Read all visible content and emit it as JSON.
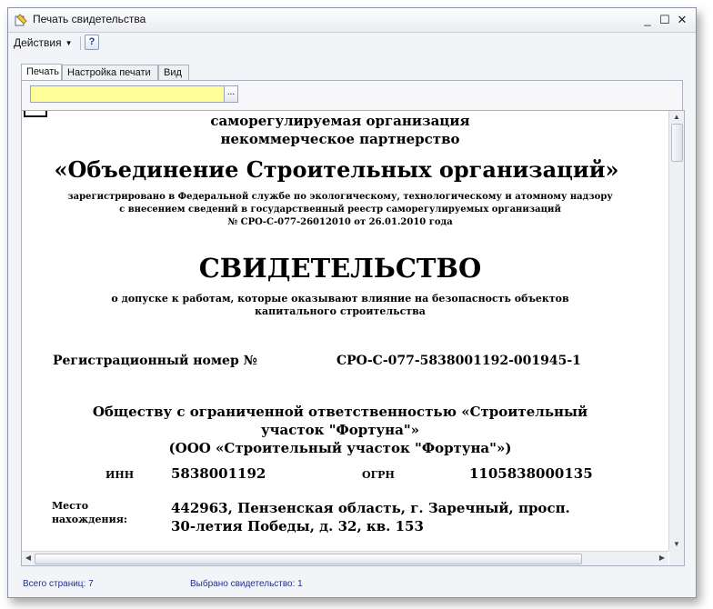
{
  "window": {
    "title": "Печать свидетельства",
    "controls": {
      "minimize": "_",
      "maximize": "☐",
      "close": "✕"
    }
  },
  "toolbar": {
    "actions_label": "Действия",
    "help_label": "?"
  },
  "tabs": [
    {
      "label": "Печать"
    },
    {
      "label": "Настройка печати"
    },
    {
      "label": "Вид"
    }
  ],
  "field": {
    "value": "",
    "button_label": "..."
  },
  "document": {
    "line1": "саморегулируемая организация",
    "line2": "некоммерческое партнерство",
    "org_name": "«Объединение Строительных организаций»",
    "reg_line1": "зарегистрировано в Федеральной службе по экологическому, технологическому и атомному надзору",
    "reg_line2": "с внесением сведений в государственный реестр саморегулируемых организаций",
    "reg_line3": "№ СРО-С-077-26012010 от 26.01.2010 года",
    "heading": "СВИДЕТЕЛЬСТВО",
    "sub1": "о допуске к работам, которые оказывают влияние на безопасность объектов",
    "sub2": "капитального строительства",
    "regnum_label": "Регистрационный номер №",
    "regnum_value": "СРО-С-077-5838001192-001945-1",
    "company1": "Обществу с ограниченной ответственностью «Строительный",
    "company2": "участок \"Фортуна\"»",
    "company3": "(ООО «Строительный участок \"Фортуна\"»)",
    "inn_label": "ИНН",
    "inn_value": "5838001192",
    "ogrn_label": "ОГРН",
    "ogrn_value": "1105838000135",
    "addr_label1": "Место",
    "addr_label2": "нахождения:",
    "addr1": "442963, Пензенская область, г. Заречный, просп.",
    "addr2": "30-летия Победы, д. 32, кв. 153"
  },
  "status": {
    "pages": "Всего страниц: 7",
    "selected": "Выбрано свидетельство: 1"
  }
}
